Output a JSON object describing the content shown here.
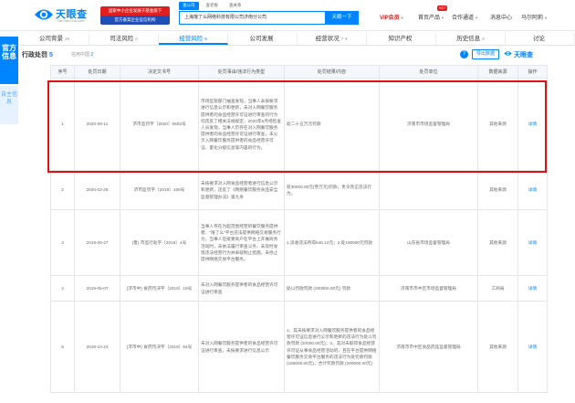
{
  "header": {
    "logo_text": "天眼查",
    "logo_sub": "TianYanCha.com",
    "promo_line1": "国家中小企业发展子基金旗下",
    "promo_line2": "官方备案企业征信机构",
    "search_tabs": [
      "查公司",
      "查老板",
      "查关系"
    ],
    "search_value": "上海饿了么网络科技有限公司济南分公司",
    "search_button": "天眼一下",
    "vip": "VIP会员",
    "products": "首页产品",
    "hot_badge": "HOT",
    "cooperation": "合作通道",
    "messages": "消息中心",
    "user": "马尔阿莉"
  },
  "side": {
    "primary": "官方信息",
    "secondary": "自主信息"
  },
  "tabs": [
    {
      "label": "公司背景",
      "count": "26"
    },
    {
      "label": "司法风险",
      "count": "0"
    },
    {
      "label": "经营风险",
      "count": "5"
    },
    {
      "label": "公司发展",
      "count": ""
    },
    {
      "label": "经营状况",
      "count": "7"
    },
    {
      "label": "知识产权",
      "count": ""
    },
    {
      "label": "历史信息",
      "count": "8"
    },
    {
      "label": "讨论",
      "count": ""
    }
  ],
  "section": {
    "title": "行政处罚",
    "title_count": "5",
    "tag_label": "信用中国",
    "tag_count": "2",
    "export": "导出数据",
    "brand": "天眼查"
  },
  "table": {
    "headers": [
      "序号",
      "处罚日期",
      "决定文书号",
      "处罚事由/违法行为类型",
      "处罚结果/内容",
      "处罚单位",
      "数据来源",
      "操作"
    ],
    "rows": [
      {
        "no": "1",
        "date": "2020-08-11",
        "doc": "济市监罚字〔2020〕0602号",
        "reason": "市场监管部门抽查发现，当事人未按要求进行信息公示和更新，未对入网餐饮服务提供者的食品经营许可证进行审查的行为均违反了相关法规规定，2020年6月经检查人员发现，当事人仍存在对入网餐饮服务提供者的食品经营许可证进行审查，未公示入网餐饮服务提供者的食品经营许可证、量化分级信息等内容的行为。",
        "result": "处二十五万元罚款",
        "authority": "济南市市场监督管理局",
        "source": "其他来源",
        "action": "详情"
      },
      {
        "no": "2",
        "date": "2020-02-26",
        "doc": "济市监罚字〔2019〕155号",
        "reason": "未按要求对入网食品经营者进行信息公示和更新，违反了《网络餐饮服务食品安全监督管理办法》第九条",
        "result": "处30000.00元(叁万元)罚款，责令改正违法行为。",
        "authority": "",
        "source": "其他来源",
        "action": "详情"
      },
      {
        "no": "3",
        "date": "2019-09-27",
        "doc": "(鲁) 市监行处字〔2019〕4号",
        "reason": "当事人存在为超范围经营的餐饮服务提供者、\"限了么\"平台违法提供网络交易服务行为，当事人在接受商户在平台上开展商务活动时，未依法履行审查义务，未及时发现违法经营行为并采取制止措施，未停止提供网络交易平台服务。",
        "result": "1.没收违法所得646.12元；2.处190000元罚款",
        "authority": "山东省市场监督管理局",
        "source": "其他来源",
        "action": "详情"
      },
      {
        "no": "4",
        "date": "2019-05-07",
        "doc": "(济市中) 食药罚决字〔2019〕19号",
        "reason": "未对入网餐饮服务提供者的食品经营许可证进行审查",
        "result": "处以罚款罚款 (200000.00元) 罚款",
        "authority": "济南市市中区市场监督管理局",
        "source": "工商局",
        "action": "详情"
      },
      {
        "no": "5",
        "date": "2018-10-23",
        "doc": "(济市中) 食药罚决字〔2018〕64号",
        "reason": "未对入网餐饮服务提供者的食品经营许可证进行审查，未按要求进行信息公示",
        "result": "1、其未按要求对入网餐饮服务提供者的食品经营许可证信息进行公示和更新的违法行为处以罚款罚款 (20000.00元)；2、其对未取得食品经营许可证从事食品经营活动的，且在平台提供网络餐饮服务交易平台服务的违法行为处罚款罚款 (180000.00元)，合计罚款罚款 (200000.00元)",
        "authority": "济南市市中区食品药品监督管理局",
        "source": "其他来源",
        "action": "详情"
      }
    ]
  }
}
